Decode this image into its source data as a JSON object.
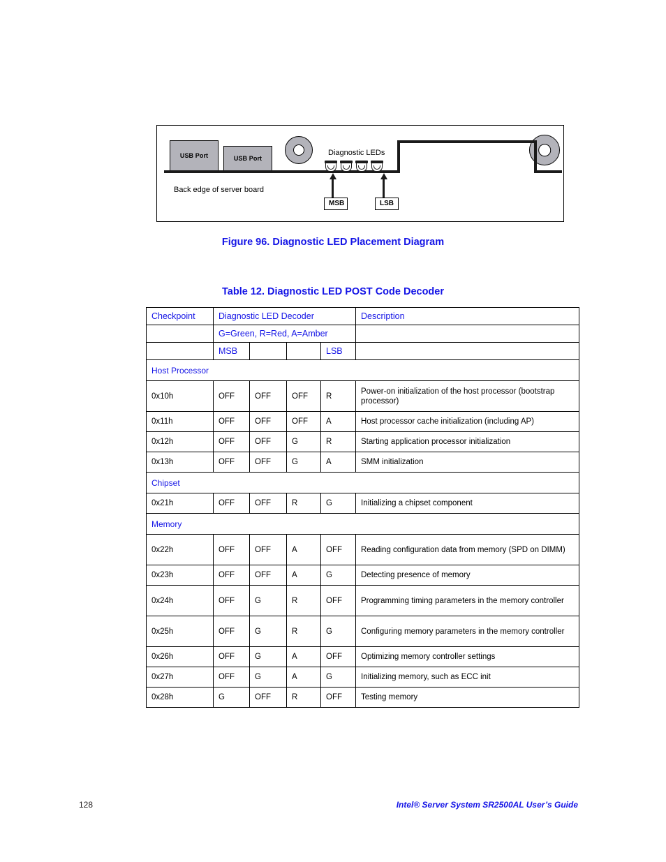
{
  "figure": {
    "caption": "Figure 96. Diagnostic LED Placement Diagram",
    "usb_port_1_label": "USB Port",
    "usb_port_2_label": "USB Port",
    "diagnostic_leds_label": "Diagnostic LEDs",
    "back_edge_label": "Back edge of server board",
    "msb_label": "MSB",
    "lsb_label": "LSB",
    "led_count": 4,
    "colors": {
      "port_fill": "#b3b3ba",
      "outline": "#000000",
      "board_edge": "#1a1a1a"
    }
  },
  "table": {
    "caption": "Table 12. Diagnostic LED POST Code Decoder",
    "headers": {
      "checkpoint": "Checkpoint",
      "decoder": "Diagnostic LED Decoder",
      "description": "Description",
      "legend": "G=Green, R=Red, A=Amber",
      "msb": "MSB",
      "lsb": "LSB"
    },
    "sections": [
      {
        "name": "Host Processor",
        "rows": [
          {
            "checkpoint": "0x10h",
            "leds": [
              "OFF",
              "OFF",
              "OFF",
              "R"
            ],
            "description": "Power-on initialization of the host processor (bootstrap processor)",
            "tall": true
          },
          {
            "checkpoint": "0x11h",
            "leds": [
              "OFF",
              "OFF",
              "OFF",
              "A"
            ],
            "description": "Host processor cache initialization (including AP)",
            "tall": false
          },
          {
            "checkpoint": "0x12h",
            "leds": [
              "OFF",
              "OFF",
              "G",
              "R"
            ],
            "description": "Starting application processor initialization",
            "tall": false
          },
          {
            "checkpoint": "0x13h",
            "leds": [
              "OFF",
              "OFF",
              "G",
              "A"
            ],
            "description": "SMM initialization",
            "tall": false
          }
        ]
      },
      {
        "name": "Chipset",
        "rows": [
          {
            "checkpoint": "0x21h",
            "leds": [
              "OFF",
              "OFF",
              "R",
              "G"
            ],
            "description": "Initializing a chipset component",
            "tall": false
          }
        ]
      },
      {
        "name": "Memory",
        "rows": [
          {
            "checkpoint": "0x22h",
            "leds": [
              "OFF",
              "OFF",
              "A",
              "OFF"
            ],
            "description": "Reading configuration data from memory (SPD on DIMM)",
            "tall": true
          },
          {
            "checkpoint": "0x23h",
            "leds": [
              "OFF",
              "OFF",
              "A",
              "G"
            ],
            "description": "Detecting presence of memory",
            "tall": false
          },
          {
            "checkpoint": "0x24h",
            "leds": [
              "OFF",
              "G",
              "R",
              "OFF"
            ],
            "description": "Programming timing parameters in the memory controller",
            "tall": true
          },
          {
            "checkpoint": "0x25h",
            "leds": [
              "OFF",
              "G",
              "R",
              "G"
            ],
            "description": "Configuring memory parameters in the memory controller",
            "tall": true
          },
          {
            "checkpoint": "0x26h",
            "leds": [
              "OFF",
              "G",
              "A",
              "OFF"
            ],
            "description": "Optimizing memory controller settings",
            "tall": false
          },
          {
            "checkpoint": "0x27h",
            "leds": [
              "OFF",
              "G",
              "A",
              "G"
            ],
            "description": "Initializing memory, such as ECC init",
            "tall": false
          },
          {
            "checkpoint": "0x28h",
            "leds": [
              "G",
              "OFF",
              "R",
              "OFF"
            ],
            "description": "Testing memory",
            "tall": false
          }
        ]
      }
    ]
  },
  "footer": {
    "page_number": "128",
    "guide_title": "Intel® Server System SR2500AL User’s Guide"
  },
  "colors": {
    "heading_blue": "#1414e6",
    "body_text": "#000000"
  }
}
